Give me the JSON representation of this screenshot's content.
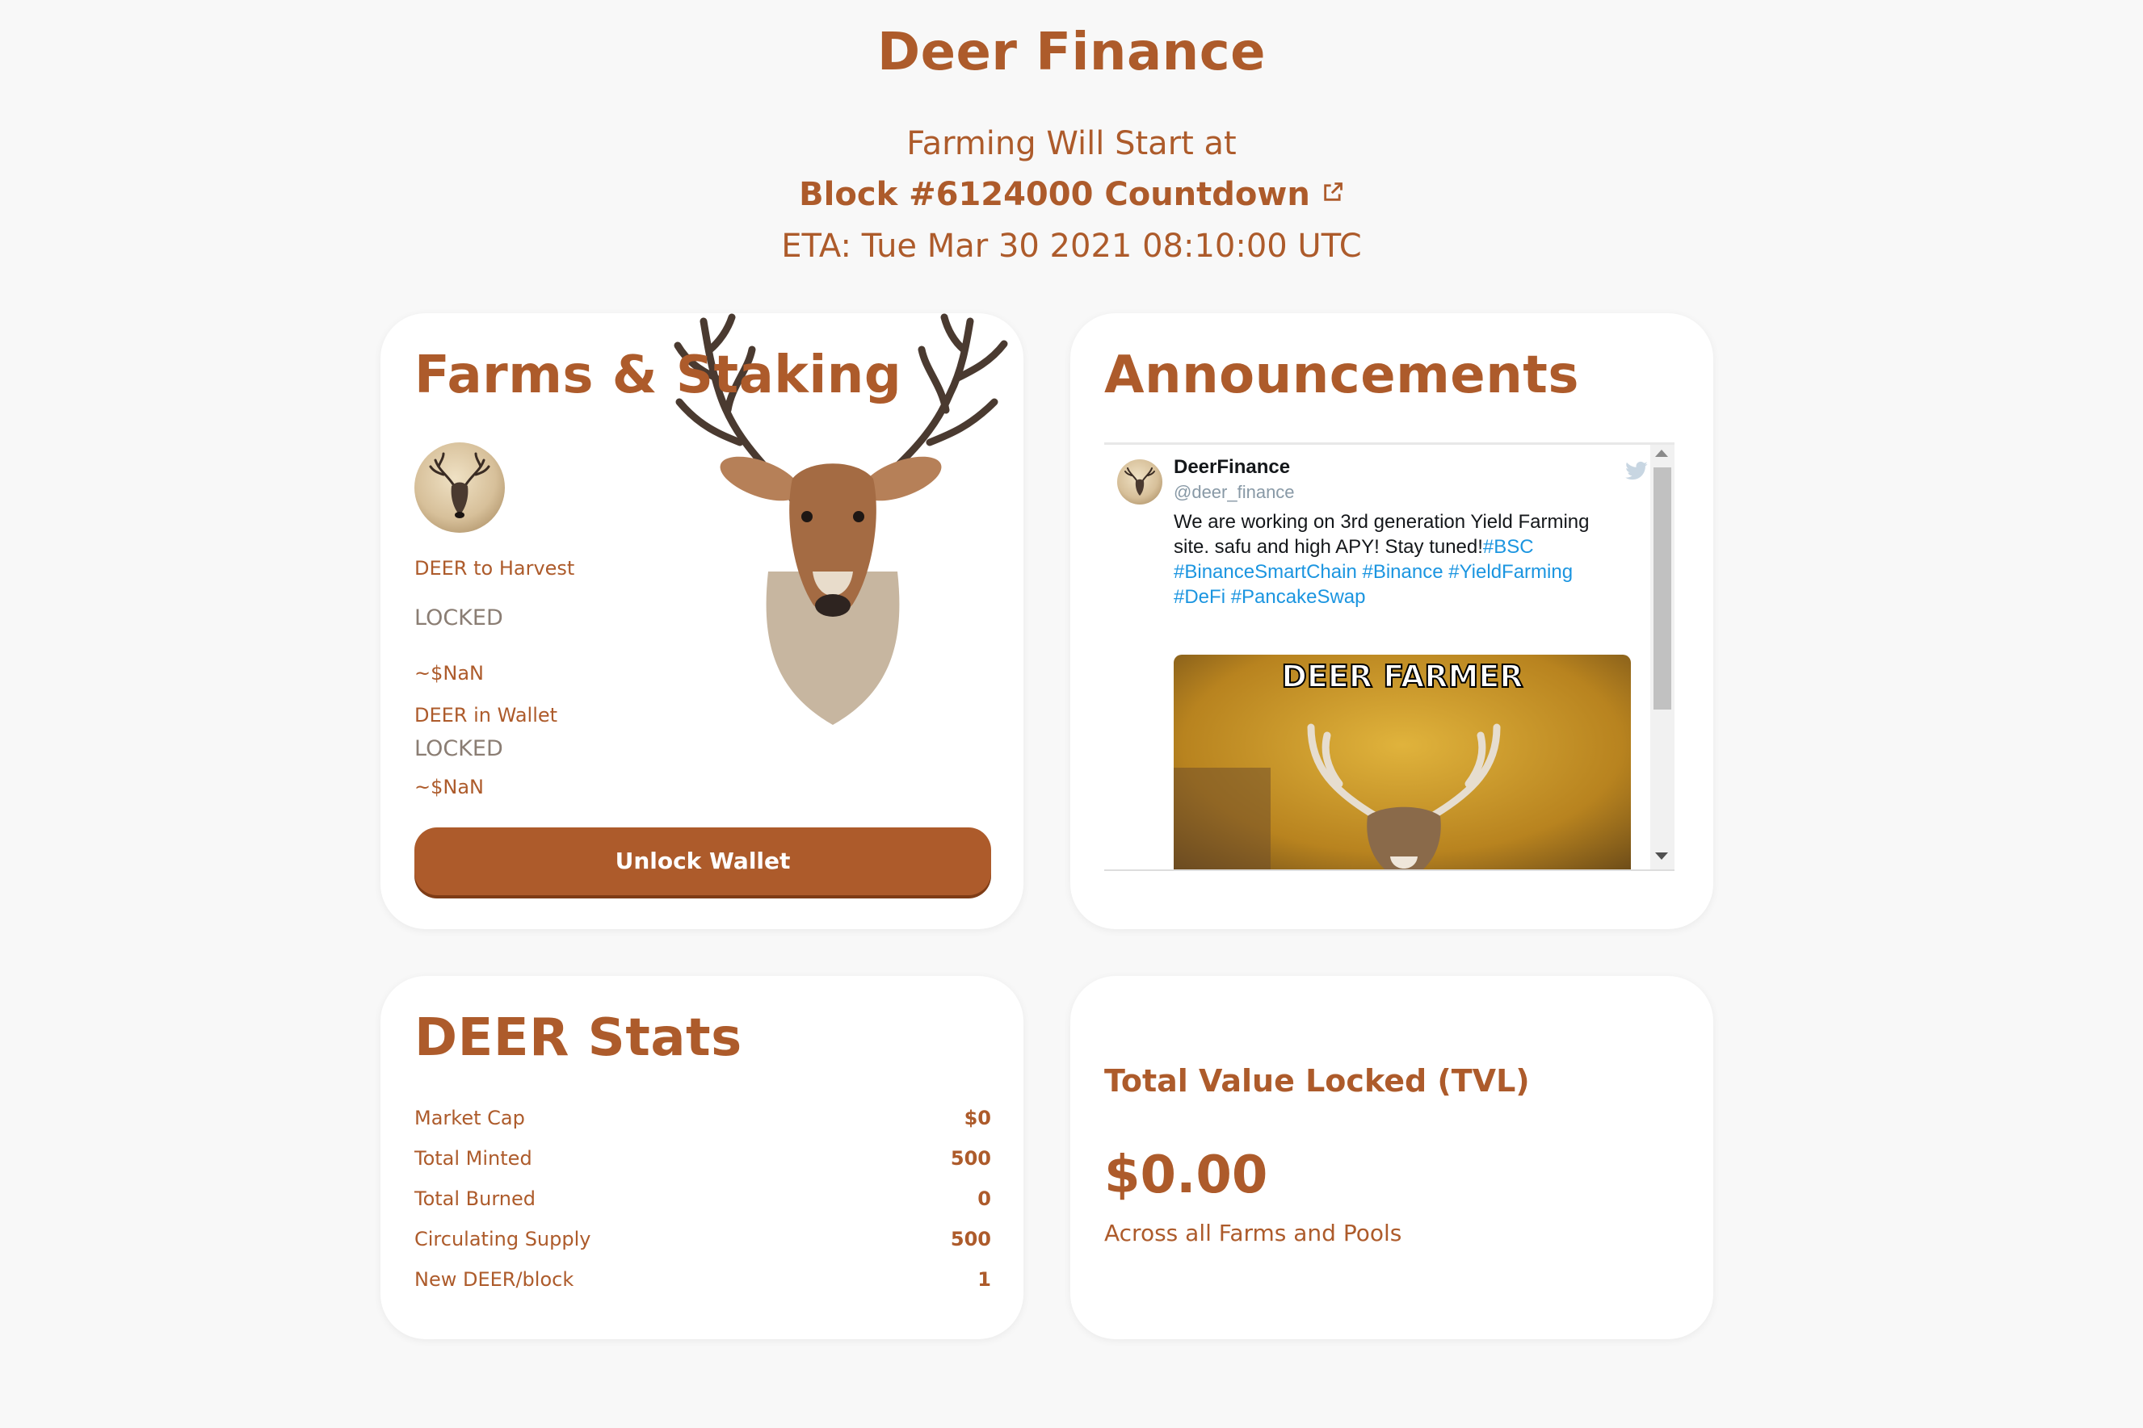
{
  "header": {
    "title": "Deer Finance",
    "farming_start": "Farming Will Start at",
    "block_countdown": "Block #6124000 Countdown",
    "eta": "ETA: Tue Mar 30 2021 08:10:00 UTC"
  },
  "farms": {
    "title": "Farms & Staking",
    "harvest_label": "DEER to Harvest",
    "harvest_value": "LOCKED",
    "harvest_usd": "~$NaN",
    "wallet_label": "DEER in Wallet",
    "wallet_value": "LOCKED",
    "wallet_usd": "~$NaN",
    "unlock_button": "Unlock Wallet"
  },
  "announcements": {
    "title": "Announcements",
    "tweet": {
      "name": "DeerFinance",
      "handle": "@deer_finance",
      "text_plain": "We are working on 3rd generation Yield Farming site. safu and high APY! Stay tuned!",
      "hashtags": [
        "#BSC",
        "#BinanceSmartChain",
        "#Binance",
        "#YieldFarming",
        "#DeFi",
        "#PancakeSwap"
      ],
      "media_caption": "DEER FARMER"
    }
  },
  "stats": {
    "title": "DEER Stats",
    "rows": [
      {
        "label": "Market Cap",
        "value": "$0"
      },
      {
        "label": "Total Minted",
        "value": "500"
      },
      {
        "label": "Total Burned",
        "value": "0"
      },
      {
        "label": "Circulating Supply",
        "value": "500"
      },
      {
        "label": "New DEER/block",
        "value": "1"
      }
    ]
  },
  "tvl": {
    "title": "Total Value Locked (TVL)",
    "value": "$0.00",
    "subtitle": "Across all Farms and Pools"
  },
  "colors": {
    "brand": "#ad5b2b",
    "background": "#f8f8f8",
    "card": "#ffffff",
    "hashtag": "#1b95e0"
  }
}
